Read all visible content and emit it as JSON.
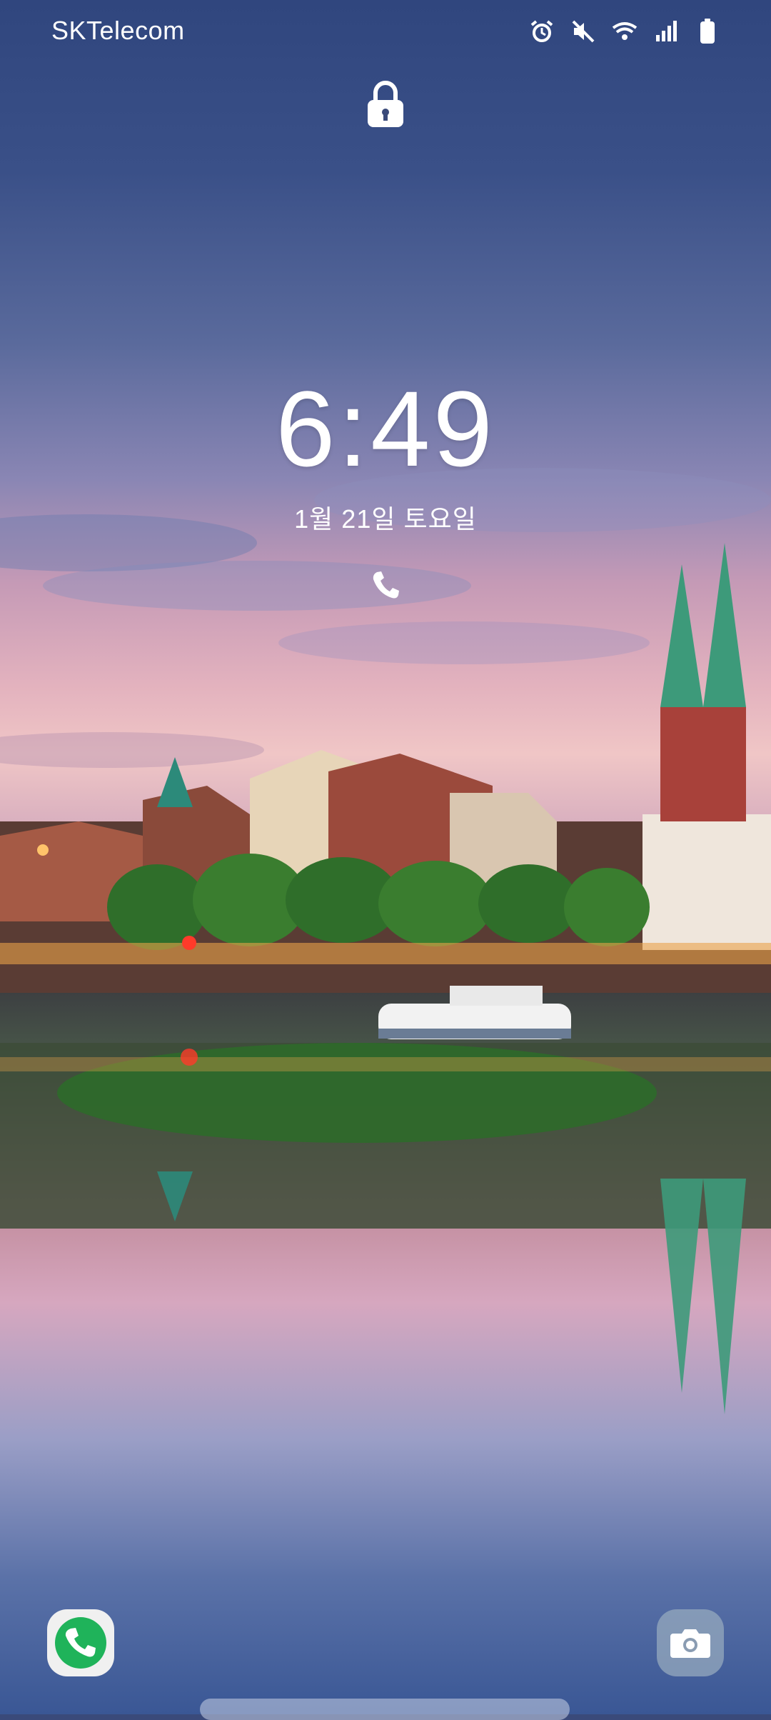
{
  "status_bar": {
    "carrier": "SKTelecom",
    "icons": [
      "alarm-icon",
      "mute-icon",
      "wifi-icon",
      "signal-icon",
      "battery-icon"
    ]
  },
  "lock_screen": {
    "time": "6:49",
    "date": "1월 21일 토요일",
    "lock_icon": "lock-icon",
    "missed_call_icon": "phone-icon"
  },
  "shortcuts": {
    "left": "phone-icon",
    "right": "camera-icon"
  },
  "colors": {
    "accent_green": "#1fb35a",
    "sky_top": "#30467e",
    "sunset_pink": "#f0c6c6"
  }
}
